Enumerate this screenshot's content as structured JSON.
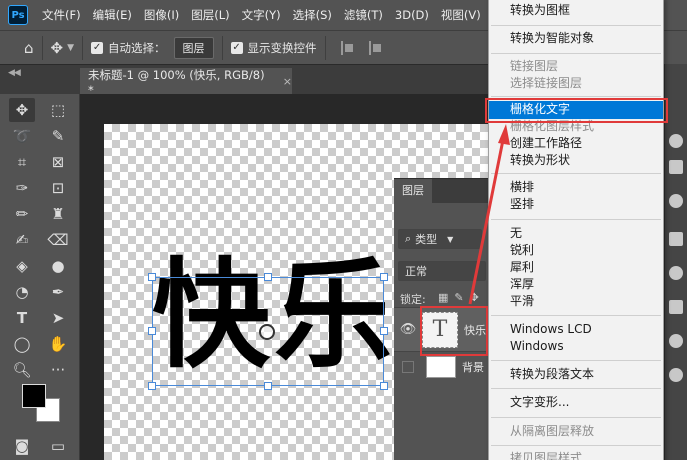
{
  "menubar": {
    "logo": "Ps",
    "items": [
      "文件(F)",
      "编辑(E)",
      "图像(I)",
      "图层(L)",
      "文字(Y)",
      "选择(S)",
      "滤镜(T)",
      "3D(D)",
      "视图(V)",
      "窗"
    ]
  },
  "options": {
    "auto_select_label": "自动选择：",
    "auto_select_target": "图层",
    "show_transform_label": "显示变换控件"
  },
  "document_tab": {
    "title": "未标题-1 @ 100% (快乐, RGB/8) *",
    "close": "×"
  },
  "canvas": {
    "text": "快乐"
  },
  "layers_panel": {
    "tab": "图层",
    "filter_label": "类型",
    "blend_mode": "正常",
    "lock_label": "锁定:",
    "text_layer_thumb": "T",
    "text_layer_name": "快乐",
    "bg_layer_name": "背景"
  },
  "context_menu": {
    "items": [
      {
        "label": "转换为图框",
        "disabled": false
      },
      {
        "label": "转换为智能对象",
        "disabled": false
      },
      {
        "label": "链接图层",
        "disabled": true
      },
      {
        "label": "选择链接图层",
        "disabled": true
      },
      {
        "label": "栅格化文字",
        "disabled": false,
        "selected": true
      },
      {
        "label": "栅格化图层样式",
        "disabled": true
      },
      {
        "label": "创建工作路径",
        "disabled": false
      },
      {
        "label": "转换为形状",
        "disabled": false
      },
      {
        "label": "横排",
        "disabled": false
      },
      {
        "label": "竖排",
        "disabled": false
      },
      {
        "label": "无",
        "disabled": false
      },
      {
        "label": "锐利",
        "disabled": false
      },
      {
        "label": "犀利",
        "disabled": false
      },
      {
        "label": "浑厚",
        "disabled": false
      },
      {
        "label": "平滑",
        "disabled": false
      },
      {
        "label": "Windows LCD",
        "disabled": false
      },
      {
        "label": "Windows",
        "disabled": false
      },
      {
        "label": "转换为段落文本",
        "disabled": false
      },
      {
        "label": "文字变形...",
        "disabled": false
      },
      {
        "label": "从隔离图层释放",
        "disabled": true
      },
      {
        "label": "拷贝图层样式",
        "disabled": true
      }
    ]
  },
  "colors": {
    "menu_highlight": "#0078d7",
    "annotation_red": "#e03a3a",
    "transform_box": "#4a8ad8"
  }
}
